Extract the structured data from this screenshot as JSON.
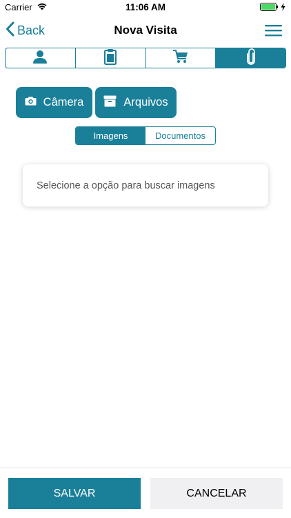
{
  "status_bar": {
    "carrier": "Carrier",
    "time": "11:06 AM",
    "battery_color": "#4cd964"
  },
  "nav": {
    "back_label": "Back",
    "title": "Nova Visita",
    "menu_icon": "hamburger-menu-icon"
  },
  "tabs": [
    {
      "icon": "person-icon",
      "active": false
    },
    {
      "icon": "clipboard-icon",
      "active": false
    },
    {
      "icon": "cart-icon",
      "active": false
    },
    {
      "icon": "paperclip-icon",
      "active": true
    }
  ],
  "actions": {
    "camera_label": "Câmera",
    "camera_icon": "camera-icon",
    "files_label": "Arquivos",
    "files_icon": "archive-box-icon"
  },
  "media_toggle": {
    "images_label": "Imagens",
    "documents_label": "Documentos",
    "selected": "Imagens"
  },
  "info_card": {
    "message": "Selecione a opção para buscar imagens"
  },
  "footer": {
    "save_label": "SALVAR",
    "cancel_label": "CANCELAR"
  },
  "colors": {
    "accent": "#1a7f99",
    "cancel_bg": "#f0f0f3"
  }
}
